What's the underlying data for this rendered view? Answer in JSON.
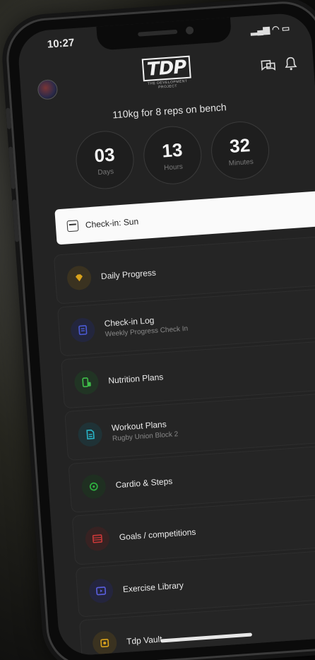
{
  "status": {
    "time": "10:27"
  },
  "header": {
    "logo_text": "TDP",
    "logo_sub": "THE DEVELOPMENT PROJECT"
  },
  "goal_text": "110kg for 8 reps on bench",
  "countdown": [
    {
      "value": "03",
      "label": "Days"
    },
    {
      "value": "13",
      "label": "Hours"
    },
    {
      "value": "32",
      "label": "Minutes"
    }
  ],
  "checkin_label": "Check-in: Sun",
  "menu": [
    {
      "title": "Daily Progress",
      "subtitle": "",
      "icon": "diamond-icon",
      "color": "#d9a21b",
      "bg": "#3a3220"
    },
    {
      "title": "Check-in Log",
      "subtitle": "Weekly Progress Check In",
      "icon": "clipboard-icon",
      "color": "#4b5bd6",
      "bg": "#23263d"
    },
    {
      "title": "Nutrition Plans",
      "subtitle": "",
      "icon": "nutrition-icon",
      "color": "#3fbf4a",
      "bg": "#213424"
    },
    {
      "title": "Workout Plans",
      "subtitle": "Rugby Union Block 2",
      "icon": "document-icon",
      "color": "#28b6c9",
      "bg": "#1f3236"
    },
    {
      "title": "Cardio & Steps",
      "subtitle": "",
      "icon": "cardio-icon",
      "color": "#2fb040",
      "bg": "#1f2f21"
    },
    {
      "title": "Goals / competitions",
      "subtitle": "",
      "icon": "goals-icon",
      "color": "#c93838",
      "bg": "#372222"
    },
    {
      "title": "Exercise Library",
      "subtitle": "",
      "icon": "library-icon",
      "color": "#5a5fe0",
      "bg": "#24253d"
    },
    {
      "title": "Tdp Vault",
      "subtitle": "",
      "icon": "vault-icon",
      "color": "#d9a21b",
      "bg": "#3a3220"
    }
  ]
}
